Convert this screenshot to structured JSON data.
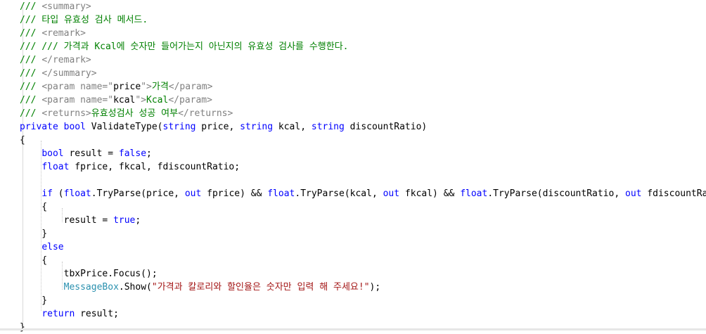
{
  "editor": {
    "lines": [
      {
        "tokens": [
          [
            "comment",
            "/// "
          ],
          [
            "xmltag",
            "<summary>"
          ]
        ]
      },
      {
        "tokens": [
          [
            "comment",
            "/// 타입 유효성 검사 메서드."
          ]
        ]
      },
      {
        "tokens": [
          [
            "comment",
            "/// "
          ],
          [
            "xmltag",
            "<remark>"
          ]
        ]
      },
      {
        "tokens": [
          [
            "comment",
            "/// /// 가격과 Kcal에 숫자만 들어가는지 아닌지의 유효성 검사를 수행한다."
          ]
        ]
      },
      {
        "tokens": [
          [
            "comment",
            "/// "
          ],
          [
            "xmltag",
            "</remark>"
          ]
        ]
      },
      {
        "tokens": [
          [
            "comment",
            "/// "
          ],
          [
            "xmltag",
            "</summary>"
          ]
        ]
      },
      {
        "tokens": [
          [
            "comment",
            "/// "
          ],
          [
            "xmltag",
            "<param name=\""
          ],
          [
            "xmlval",
            "price"
          ],
          [
            "xmltag",
            "\">"
          ],
          [
            "comment",
            "가격"
          ],
          [
            "xmltag",
            "</param>"
          ]
        ]
      },
      {
        "tokens": [
          [
            "comment",
            "/// "
          ],
          [
            "xmltag",
            "<param name=\""
          ],
          [
            "xmlval",
            "kcal"
          ],
          [
            "xmltag",
            "\">"
          ],
          [
            "comment",
            "Kcal"
          ],
          [
            "xmltag",
            "</param>"
          ]
        ]
      },
      {
        "tokens": [
          [
            "comment",
            "/// "
          ],
          [
            "xmltag",
            "<returns>"
          ],
          [
            "comment",
            "유효성검사 성공 여부"
          ],
          [
            "xmltag",
            "</returns>"
          ]
        ]
      },
      {
        "tokens": [
          [
            "keyword",
            "private"
          ],
          [
            "ident",
            " "
          ],
          [
            "keyword",
            "bool"
          ],
          [
            "ident",
            " ValidateType("
          ],
          [
            "keyword",
            "string"
          ],
          [
            "ident",
            " price, "
          ],
          [
            "keyword",
            "string"
          ],
          [
            "ident",
            " kcal, "
          ],
          [
            "keyword",
            "string"
          ],
          [
            "ident",
            " discountRatio)"
          ]
        ]
      },
      {
        "tokens": [
          [
            "punct",
            "{"
          ]
        ]
      },
      {
        "tokens": [
          [
            "ident",
            "    "
          ],
          [
            "keyword",
            "bool"
          ],
          [
            "ident",
            " result = "
          ],
          [
            "keyword",
            "false"
          ],
          [
            "ident",
            ";"
          ]
        ]
      },
      {
        "tokens": [
          [
            "ident",
            "    "
          ],
          [
            "keyword",
            "float"
          ],
          [
            "ident",
            " fprice, fkcal, fdiscountRatio;"
          ]
        ]
      },
      {
        "tokens": [
          [
            "ident",
            ""
          ]
        ]
      },
      {
        "tokens": [
          [
            "ident",
            "    "
          ],
          [
            "keyword",
            "if"
          ],
          [
            "ident",
            " ("
          ],
          [
            "keyword",
            "float"
          ],
          [
            "ident",
            ".TryParse(price, "
          ],
          [
            "keyword",
            "out"
          ],
          [
            "ident",
            " fprice) && "
          ],
          [
            "keyword",
            "float"
          ],
          [
            "ident",
            ".TryParse(kcal, "
          ],
          [
            "keyword",
            "out"
          ],
          [
            "ident",
            " fkcal) && "
          ],
          [
            "keyword",
            "float"
          ],
          [
            "ident",
            ".TryParse(discountRatio, "
          ],
          [
            "keyword",
            "out"
          ],
          [
            "ident",
            " fdiscountRatio))"
          ]
        ]
      },
      {
        "tokens": [
          [
            "ident",
            "    {"
          ]
        ]
      },
      {
        "tokens": [
          [
            "ident",
            "        result = "
          ],
          [
            "keyword",
            "true"
          ],
          [
            "ident",
            ";"
          ]
        ]
      },
      {
        "tokens": [
          [
            "ident",
            "    }"
          ]
        ]
      },
      {
        "tokens": [
          [
            "ident",
            "    "
          ],
          [
            "keyword",
            "else"
          ]
        ]
      },
      {
        "tokens": [
          [
            "ident",
            "    {"
          ]
        ]
      },
      {
        "tokens": [
          [
            "ident",
            "        tbxPrice.Focus();"
          ]
        ]
      },
      {
        "tokens": [
          [
            "ident",
            "        "
          ],
          [
            "type",
            "MessageBox"
          ],
          [
            "ident",
            ".Show("
          ],
          [
            "string",
            "\"가격과 칼로리와 할인율은 숫자만 입력 해 주세요!\""
          ],
          [
            "ident",
            ");"
          ]
        ]
      },
      {
        "tokens": [
          [
            "ident",
            "    }"
          ]
        ]
      },
      {
        "tokens": [
          [
            "ident",
            "    "
          ],
          [
            "keyword",
            "return"
          ],
          [
            "ident",
            " result;"
          ]
        ]
      },
      {
        "tokens": [
          [
            "punct",
            "}"
          ]
        ]
      }
    ]
  }
}
